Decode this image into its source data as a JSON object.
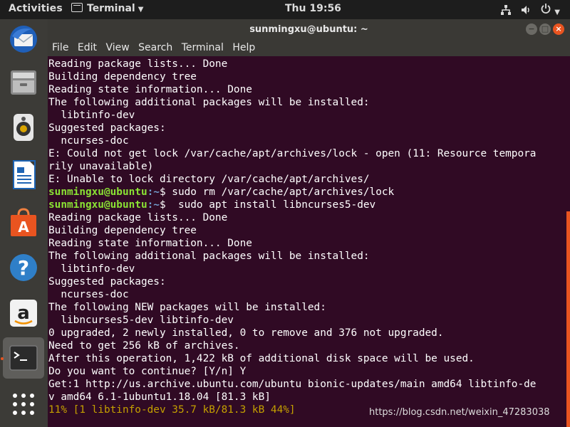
{
  "topbar": {
    "activities": "Activities",
    "app_name": "Terminal",
    "clock": "Thu 19:56"
  },
  "dock": {
    "items": [
      {
        "icon": "thunderbird-icon"
      },
      {
        "icon": "files-icon"
      },
      {
        "icon": "rhythmbox-icon"
      },
      {
        "icon": "libreoffice-writer-icon"
      },
      {
        "icon": "ubuntu-software-icon"
      },
      {
        "icon": "help-icon"
      },
      {
        "icon": "amazon-icon"
      },
      {
        "icon": "terminal-icon"
      },
      {
        "icon": "show-applications-icon"
      }
    ]
  },
  "window": {
    "title": "sunmingxu@ubuntu: ~",
    "menu": [
      "File",
      "Edit",
      "View",
      "Search",
      "Terminal",
      "Help"
    ]
  },
  "terminal": {
    "lines": [
      {
        "text": "Reading package lists... Done"
      },
      {
        "text": "Building dependency tree"
      },
      {
        "text": "Reading state information... Done"
      },
      {
        "text": "The following additional packages will be installed:"
      },
      {
        "text": "  libtinfo-dev"
      },
      {
        "text": "Suggested packages:"
      },
      {
        "text": "  ncurses-doc"
      },
      {
        "text": "E: Could not get lock /var/cache/apt/archives/lock - open (11: Resource tempora"
      },
      {
        "text": "rily unavailable)"
      },
      {
        "text": "E: Unable to lock directory /var/cache/apt/archives/"
      },
      {
        "user": "sunmingxu@ubuntu",
        "path": ":~",
        "text": "$ sudo rm /var/cache/apt/archives/lock"
      },
      {
        "user": "sunmingxu@ubuntu",
        "path": ":~",
        "text": "$  sudo apt install libncurses5-dev"
      },
      {
        "text": "Reading package lists... Done"
      },
      {
        "text": "Building dependency tree"
      },
      {
        "text": "Reading state information... Done"
      },
      {
        "text": "The following additional packages will be installed:"
      },
      {
        "text": "  libtinfo-dev"
      },
      {
        "text": "Suggested packages:"
      },
      {
        "text": "  ncurses-doc"
      },
      {
        "text": "The following NEW packages will be installed:"
      },
      {
        "text": "  libncurses5-dev libtinfo-dev"
      },
      {
        "text": "0 upgraded, 2 newly installed, 0 to remove and 376 not upgraded."
      },
      {
        "text": "Need to get 256 kB of archives."
      },
      {
        "text": "After this operation, 1,422 kB of additional disk space will be used."
      },
      {
        "text": "Do you want to continue? [Y/n] Y"
      },
      {
        "text": "Get:1 http://us.archive.ubuntu.com/ubuntu bionic-updates/main amd64 libtinfo-de"
      },
      {
        "text": "v amd64 6.1-1ubuntu1.18.04 [81.3 kB]"
      },
      {
        "progress": "11% [1 libtinfo-dev 35.7 kB/81.3 kB 44%]"
      }
    ]
  },
  "watermark": "https://blog.csdn.net/weixin_47283038",
  "colors": {
    "terminal_bg": "#300a24",
    "prompt_user": "#8ae234",
    "prompt_path": "#729fcf",
    "progress": "#c4a000",
    "accent": "#e95420"
  }
}
